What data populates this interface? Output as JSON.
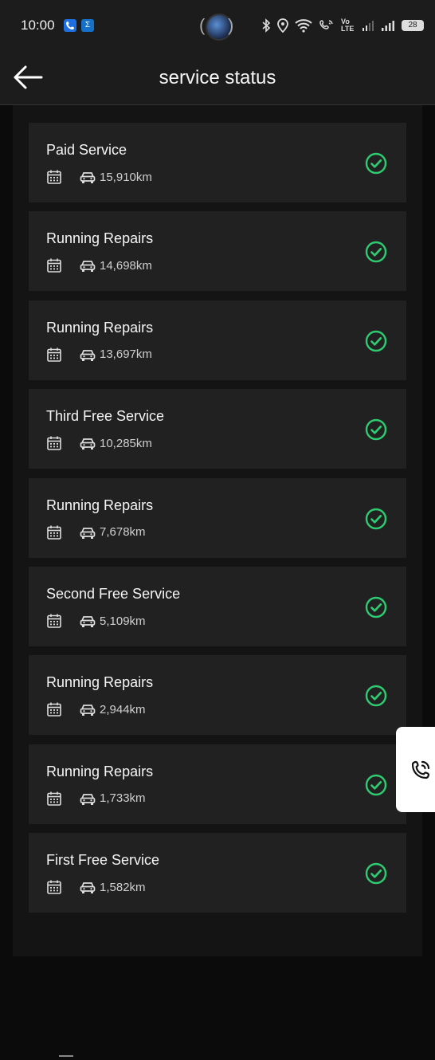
{
  "status_bar": {
    "time": "10:00",
    "app_icon_1": "phone-app-icon",
    "app_icon_2": "sigma-app-icon",
    "sigma_glyph": "Σ",
    "network_label": "Vo LTE",
    "battery": "28"
  },
  "header": {
    "title": "service status",
    "back_icon": "back-arrow-icon"
  },
  "services": [
    {
      "title": "Paid Service",
      "km": "15,910km",
      "status": "completed"
    },
    {
      "title": "Running Repairs",
      "km": "14,698km",
      "status": "completed"
    },
    {
      "title": "Running Repairs",
      "km": "13,697km",
      "status": "completed"
    },
    {
      "title": "Third Free Service",
      "km": "10,285km",
      "status": "completed"
    },
    {
      "title": "Running Repairs",
      "km": "7,678km",
      "status": "completed"
    },
    {
      "title": "Second Free Service",
      "km": "5,109km",
      "status": "completed"
    },
    {
      "title": "Running Repairs",
      "km": "2,944km",
      "status": "completed"
    },
    {
      "title": "Running Repairs",
      "km": "1,733km",
      "status": "completed"
    },
    {
      "title": "First Free Service",
      "km": "1,582km",
      "status": "completed"
    }
  ],
  "floating_button": {
    "icon": "phone-call-icon"
  },
  "colors": {
    "accent_check": "#2ecc71",
    "card_bg": "#212121",
    "page_bg": "#0b0b0b"
  }
}
